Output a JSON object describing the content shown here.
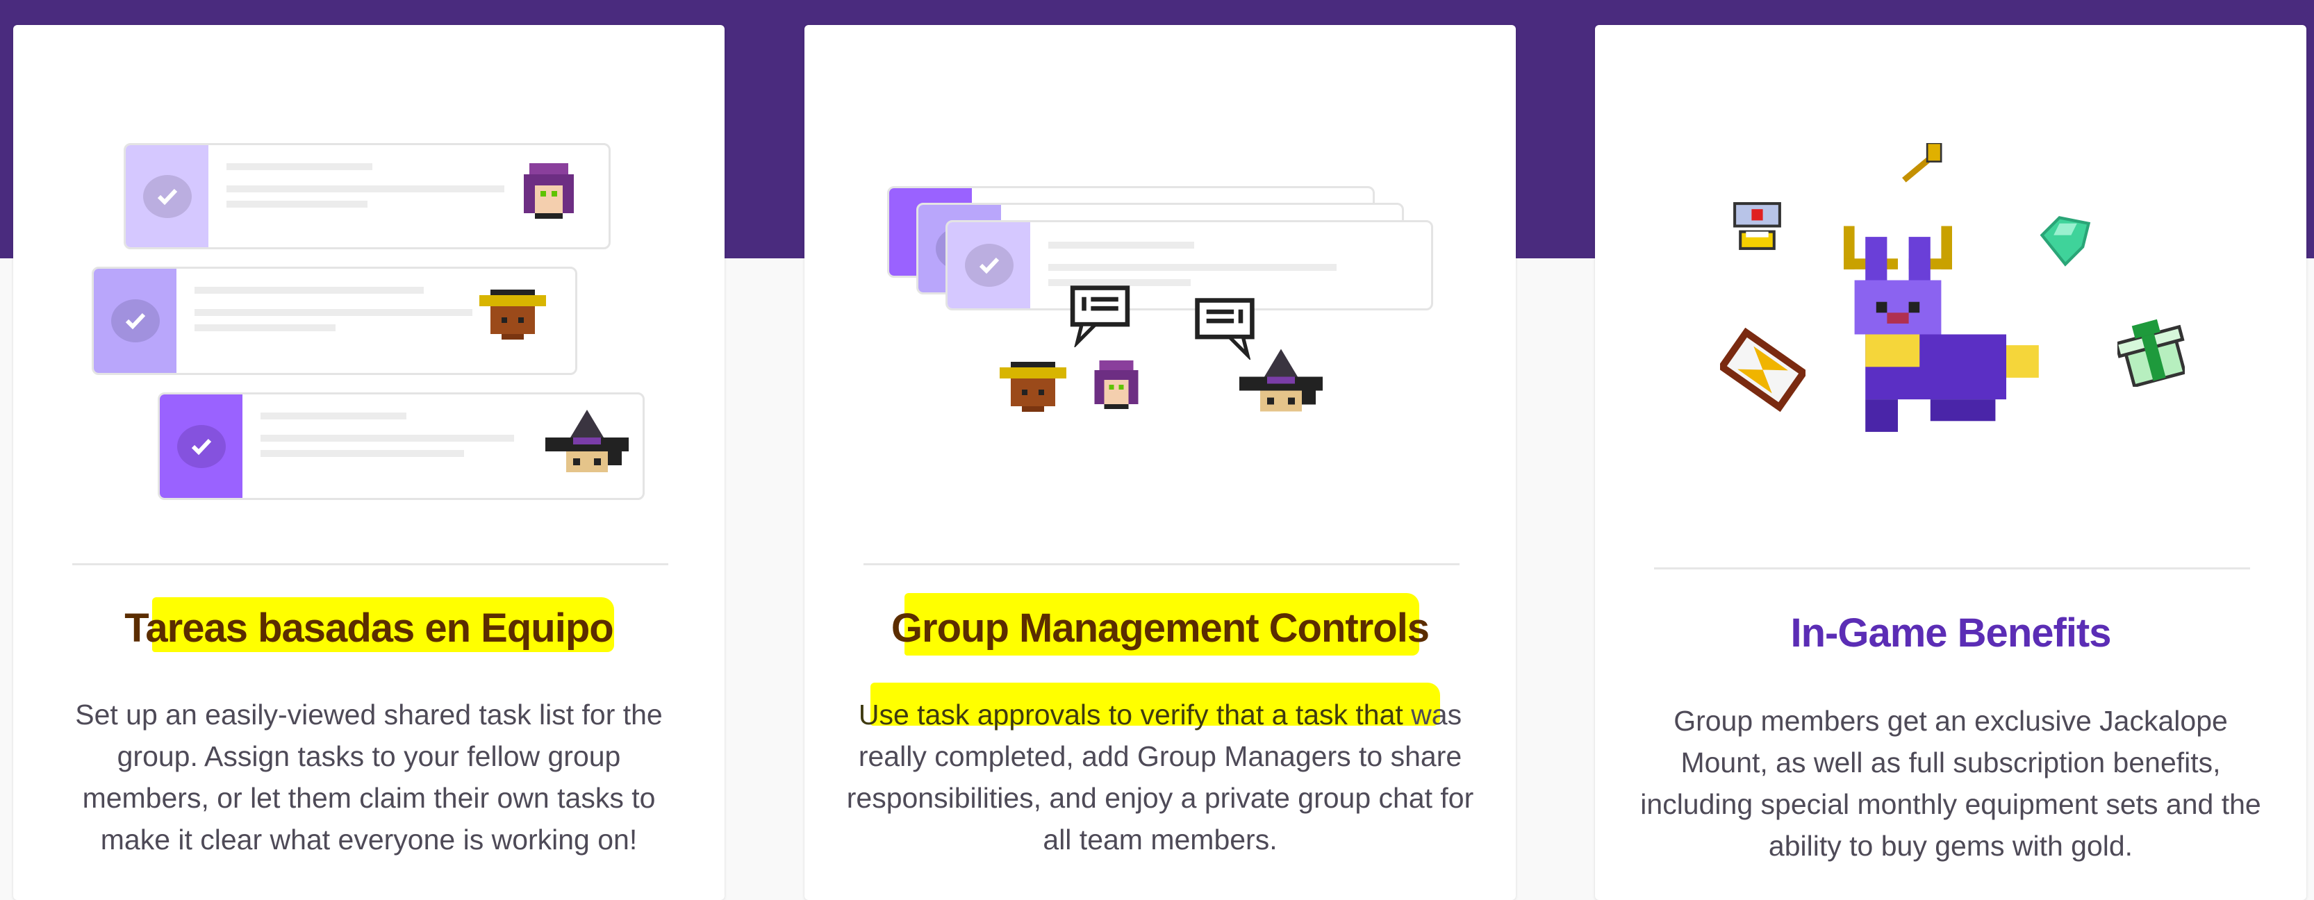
{
  "colors": {
    "header_band": "#4a2b7e",
    "highlight": "#ffff00",
    "title_highlighted": "#5b2d00",
    "title_purple": "#5b2db5",
    "body_text": "#4e4a57",
    "task_light": "#d5c8ff",
    "task_mid": "#b9a6fb",
    "task_dark": "#9a62ff"
  },
  "cards": [
    {
      "title": "Tareas basadas en Equipo",
      "body": "Set up an easily-viewed shared task list for the group. Assign tasks to your fellow group members, or let them claim their own tasks to make it clear what everyone is working on!",
      "illustration": "shared-task-list",
      "highlighted_title": true
    },
    {
      "title": "Group Management Controls",
      "body_highlight": "Use task approvals to verify that a task that",
      "body_rest": "was really completed, add Group Managers to share responsibilities, and enjoy a private group chat for all team members.",
      "illustration": "group-chat",
      "highlighted_title": true
    },
    {
      "title": "In-Game Benefits",
      "body": "Group members get an exclusive Jackalope Mount, as well as full subscription benefits, including special monthly equipment sets and the ability to buy gems with gold.",
      "illustration": "jackalope-mount-and-items",
      "highlighted_title": false
    }
  ]
}
